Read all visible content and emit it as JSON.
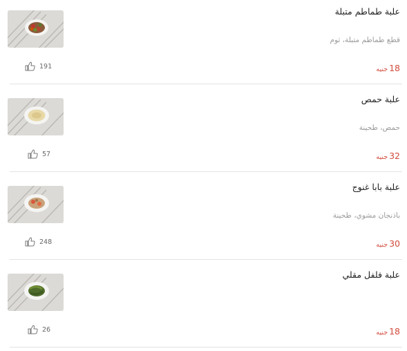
{
  "items": [
    {
      "title": "علبة طماطم متبلة",
      "description": "قطع طماطم متبلة، ثوم",
      "price": "18",
      "currency": "جنيه",
      "likes": "191",
      "food": "tomato"
    },
    {
      "title": "علبة حمص",
      "description": "حمص، طحينة",
      "price": "32",
      "currency": "جنيه",
      "likes": "57",
      "food": "hummus"
    },
    {
      "title": "علبة بابا غنوج",
      "description": "باذنجان مشوي، طحينة",
      "price": "30",
      "currency": "جنيه",
      "likes": "248",
      "food": "babaghanoush"
    },
    {
      "title": "علبة فلفل مقلي",
      "description": "",
      "price": "18",
      "currency": "جنيه",
      "likes": "26",
      "food": "pepper"
    }
  ],
  "colors": {
    "price": "#d24a3a",
    "divider": "#e3e3e3",
    "muted": "#9a9a9a"
  }
}
